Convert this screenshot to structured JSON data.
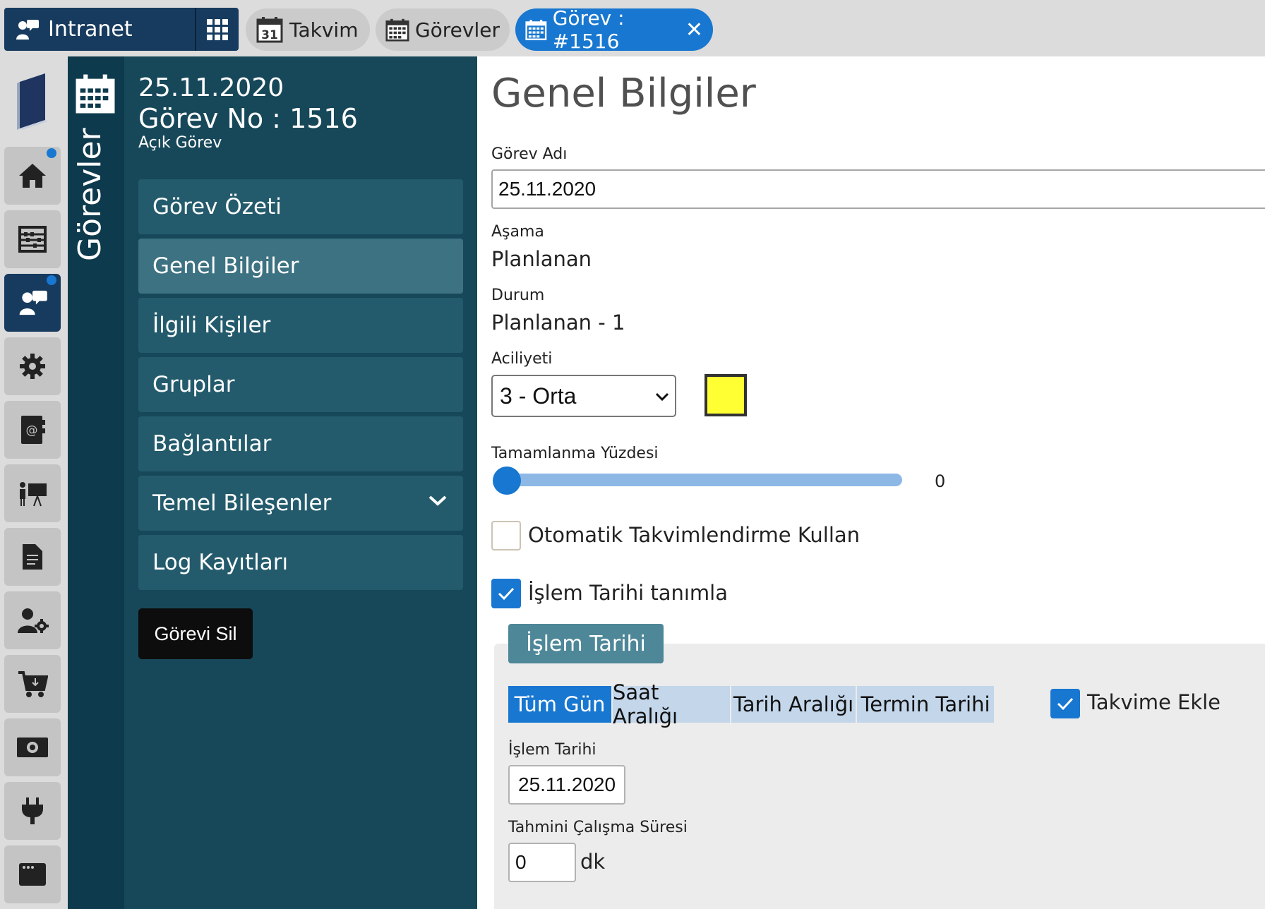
{
  "topbar": {
    "brand": "Intranet",
    "tabs": [
      {
        "label": "Takvim",
        "icon": "calendar-31-icon"
      },
      {
        "label": "Görevler",
        "icon": "calendar-grid-icon"
      },
      {
        "label": "Görev : #1516",
        "icon": "calendar-grid-icon",
        "active": true,
        "close": "✕"
      }
    ]
  },
  "rail": {
    "items": [
      "home-icon",
      "abacus-icon",
      "intranet-icon",
      "gear-icon",
      "address-book-icon",
      "presentation-icon",
      "document-icon",
      "user-settings-icon",
      "cart-icon",
      "money-icon",
      "plug-icon",
      "window-icon"
    ]
  },
  "strip": {
    "label": "Görevler"
  },
  "sidebar": {
    "date": "25.11.2020",
    "task_no": "Görev No : 1516",
    "status": "Açık Görev",
    "items": [
      {
        "label": "Görev Özeti"
      },
      {
        "label": "Genel Bilgiler"
      },
      {
        "label": "İlgili Kişiler"
      },
      {
        "label": "Gruplar"
      },
      {
        "label": "Bağlantılar"
      },
      {
        "label": "Temel Bileşenler"
      },
      {
        "label": "Log Kayıtları"
      }
    ],
    "delete_label": "Görevi Sil"
  },
  "main": {
    "title": "Genel Bilgiler",
    "task_name_label": "Görev Adı",
    "task_name_value": "25.11.2020",
    "stage_label": "Aşama",
    "stage_value": "Planlanan",
    "status_label": "Durum",
    "status_value": "Planlanan - 1",
    "priority_label": "Aciliyeti",
    "priority_value": "3 - Orta",
    "priority_color": "#ffff33",
    "completion_label": "Tamamlanma Yüzdesi",
    "completion_value": "0",
    "auto_schedule_label": "Otomatik Takvimlendirme Kullan",
    "define_date_label": "İşlem Tarihi tanımla",
    "panel_tab": "İşlem Tarihi",
    "segments": [
      "Tüm Gün",
      "Saat Aralığı",
      "Tarih Aralığı",
      "Termin Tarihi"
    ],
    "add_calendar_label": "Takvime Ekle",
    "process_date_label": "İşlem Tarihi",
    "process_date_value": "25.11.2020",
    "duration_label": "Tahmini Çalışma Süresi",
    "duration_value": "0",
    "duration_unit": "dk"
  },
  "colors": {
    "accent": "#1877d0",
    "sidebar": "#17485a",
    "brand": "#173b5e"
  }
}
